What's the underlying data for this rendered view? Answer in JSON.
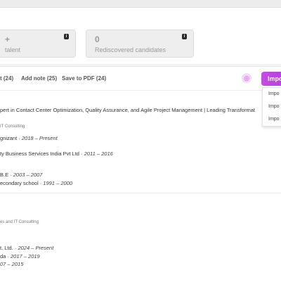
{
  "stats": [
    {
      "value": "+",
      "label": "talent"
    },
    {
      "value": "0",
      "label": "Rediscovered candidates"
    }
  ],
  "toolbar": {
    "items": [
      "t (24)",
      "Add note (25)",
      "Save to PDF (24)"
    ],
    "import_label": "Impo",
    "dropdown": [
      "Impo",
      "Impo",
      "Impo"
    ]
  },
  "candidate1": {
    "headline": "pert in Contact Center Optimization, Quality Assurance, and Agile Project Management | Leading Transformat",
    "industry": "IT Consulting",
    "jobs": [
      {
        "company": "gnizant",
        "period": "2018 – Present"
      },
      {
        "company": "ty Business Services India Pvt Ltd",
        "period": "2011 – 2016"
      }
    ],
    "education": [
      {
        "school": "B.E",
        "period": "2003 – 2007"
      },
      {
        "school": "econdary school",
        "period": "1991 – 2000"
      }
    ]
  },
  "candidate2": {
    "industry": "es and IT Consulting",
    "jobs": [
      {
        "company": "t. Ltd.",
        "period": "2024 – Present"
      },
      {
        "company": "da",
        "period": "2017 – 2019"
      },
      {
        "company": "",
        "period": "07 – 2015"
      }
    ]
  }
}
